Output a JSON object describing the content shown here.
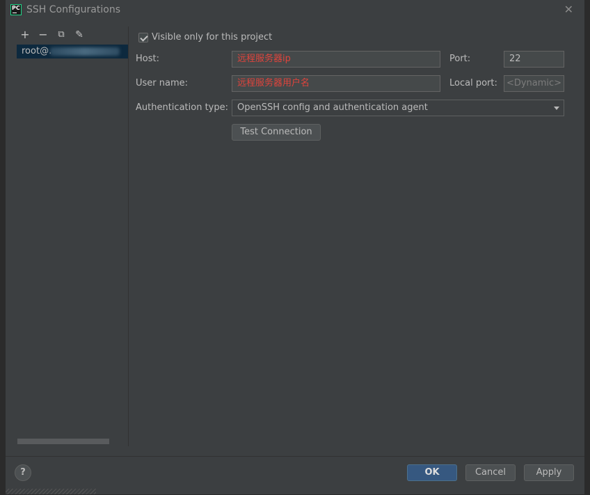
{
  "window": {
    "title": "SSH Configurations",
    "app_icon_text": "PC"
  },
  "toolbar": {
    "add": "+",
    "remove": "−",
    "copy": "⧉",
    "edit": "✎"
  },
  "list": {
    "items": [
      {
        "label": "root@."
      }
    ]
  },
  "form": {
    "visible_only_label": "Visible only for this project",
    "host_label": "Host:",
    "host_value": "远程服务器ip",
    "port_label": "Port:",
    "port_value": "22",
    "username_label": "User name:",
    "username_value": "远程服务器用户名",
    "local_port_label": "Local port:",
    "local_port_placeholder": "<Dynamic>",
    "auth_type_label": "Authentication type:",
    "auth_type_value": "OpenSSH config and authentication agent",
    "test_connection_label": "Test Connection"
  },
  "footer": {
    "help": "?",
    "ok": "OK",
    "cancel": "Cancel",
    "apply": "Apply"
  }
}
